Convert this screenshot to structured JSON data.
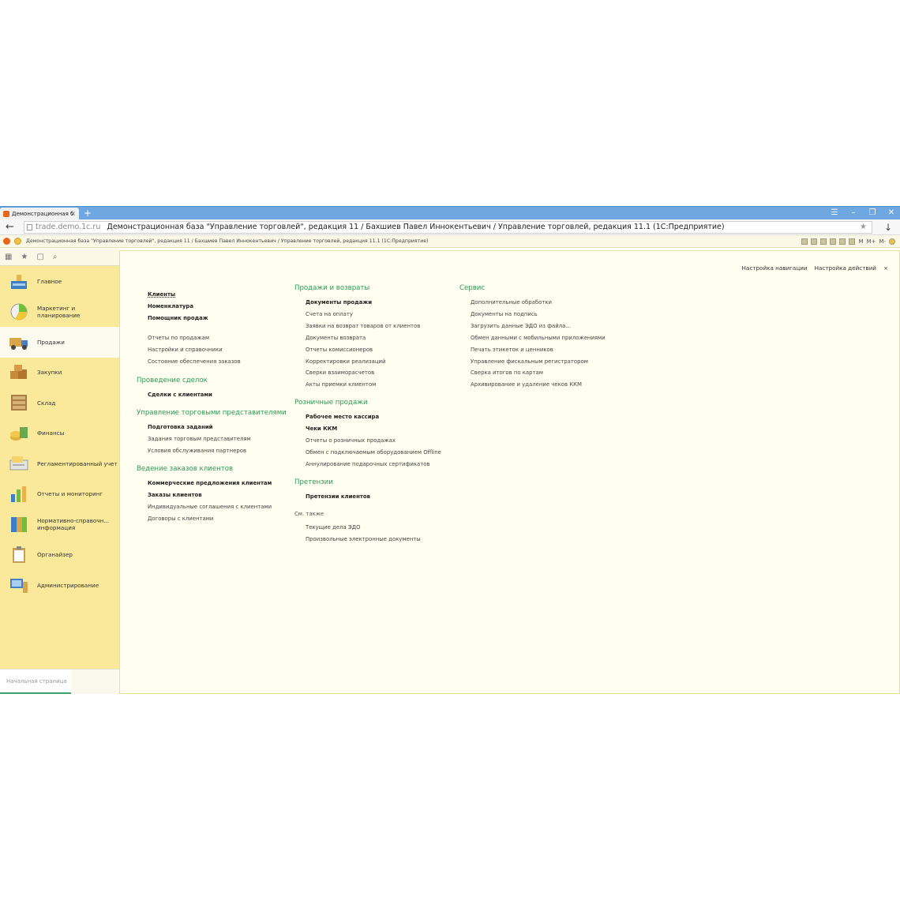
{
  "browser": {
    "tab_title": "Демонстрационная б",
    "tab_close": "×",
    "new_tab": "+",
    "window_controls": [
      "☰",
      "–",
      "❐",
      "✕"
    ],
    "back": "←",
    "url_domain": "trade.demo.1c.ru",
    "url_title": "Демонстрационная база \"Управление торговлей\", редакция 11 / Бахшиев Павел Иннокентьевич / Управление торговлей, редакция 11.1 (1С:Предприятие)",
    "star": "★",
    "download": "↓"
  },
  "app_header": {
    "title": "Демонстрационная база \"Управление торговлей\", редакция 11 / Бахшиев Павел Иннокентьевич / Управление торговлей, редакция 11.1 (1С:Предприятие)",
    "tool_labels": [
      "M",
      "M+",
      "M-"
    ]
  },
  "toolstrip": {
    "icons": [
      "apps-grid-icon",
      "favorites-star-icon",
      "history-icon",
      "search-icon"
    ]
  },
  "sidebar": {
    "items": [
      {
        "label": "Главное",
        "icon": "home-icon"
      },
      {
        "label": "Маркетинг и планирование",
        "icon": "marketing-icon"
      },
      {
        "label": "Продажи",
        "icon": "sales-truck-icon",
        "active": true
      },
      {
        "label": "Закупки",
        "icon": "purchases-boxes-icon"
      },
      {
        "label": "Склад",
        "icon": "warehouse-icon"
      },
      {
        "label": "Финансы",
        "icon": "finance-coins-icon"
      },
      {
        "label": "Регламентированный учет",
        "icon": "accounting-icon"
      },
      {
        "label": "Отчеты и мониторинг",
        "icon": "reports-chart-icon"
      },
      {
        "label": "Нормативно-справочн... информация",
        "icon": "reference-books-icon"
      },
      {
        "label": "Органайзер",
        "icon": "organizer-clipboard-icon"
      },
      {
        "label": "Администрирование",
        "icon": "admin-computer-icon"
      }
    ],
    "start_tab": "Начальная страница"
  },
  "content": {
    "nav_settings": "Настройка навигации",
    "action_settings": "Настройка действий",
    "close": "×",
    "col1": {
      "top_links": [
        {
          "label": "Клиенты",
          "bold": true
        },
        {
          "label": "Номенклатура",
          "bold": true
        },
        {
          "label": "Помощник продаж",
          "bold": true
        }
      ],
      "more_links": [
        "Отчеты по продажам",
        "Настройки и справочники",
        "Состояние обеспечения заказов"
      ],
      "sections": [
        {
          "title": "Проведение сделок",
          "links": [
            {
              "label": "Сделки с клиентами",
              "bold": true
            }
          ]
        },
        {
          "title": "Управление торговыми представителями",
          "links": [
            {
              "label": "Подготовка заданий",
              "bold": true
            },
            {
              "label": "Задания торговым представителям",
              "bold": false
            },
            {
              "label": "Условия обслуживания партнеров",
              "bold": false
            }
          ]
        },
        {
          "title": "Ведение заказов клиентов",
          "links": [
            {
              "label": "Коммерческие предложения клиентам",
              "bold": true
            },
            {
              "label": "Заказы клиентов",
              "bold": true
            },
            {
              "label": "Индивидуальные соглашения с клиентами",
              "bold": false
            },
            {
              "label": "Договоры с клиентами",
              "bold": false
            }
          ]
        }
      ]
    },
    "col2": {
      "sections": [
        {
          "title": "Продажи и возвраты",
          "links": [
            {
              "label": "Документы продажи",
              "bold": true
            },
            {
              "label": "Счета на оплату",
              "bold": false
            },
            {
              "label": "Заявки на возврат товаров от клиентов",
              "bold": false
            },
            {
              "label": "Документы возврата",
              "bold": false
            },
            {
              "label": "Отчеты комиссионеров",
              "bold": false
            },
            {
              "label": "Корректировки реализаций",
              "bold": false
            },
            {
              "label": "Сверки взаиморасчетов",
              "bold": false
            },
            {
              "label": "Акты приемки клиентом",
              "bold": false
            }
          ]
        },
        {
          "title": "Розничные продажи",
          "links": [
            {
              "label": "Рабочее место кассира",
              "bold": true
            },
            {
              "label": "Чеки ККМ",
              "bold": true
            },
            {
              "label": "Отчеты о розничных продажах",
              "bold": false
            },
            {
              "label": "Обмен с подключаемым оборудованием Offline",
              "bold": false
            },
            {
              "label": "Аннулирование подарочных сертификатов",
              "bold": false
            }
          ]
        },
        {
          "title": "Претензии",
          "links": [
            {
              "label": "Претензии клиентов",
              "bold": true
            }
          ]
        }
      ],
      "see_also": "См. также",
      "see_also_links": [
        "Текущие дела ЭДО",
        "Произвольные электронные документы"
      ]
    },
    "col3": {
      "sections": [
        {
          "title": "Сервис",
          "links": [
            {
              "label": "Дополнительные обработки",
              "bold": false
            },
            {
              "label": "Документы на подпись",
              "bold": false
            },
            {
              "label": "Загрузить данные ЭДО из файла...",
              "bold": false
            },
            {
              "label": "Обмен данными с мобильными приложениями",
              "bold": false
            },
            {
              "label": "Печать этикеток и ценников",
              "bold": false
            },
            {
              "label": "Управление фискальным регистратором",
              "bold": false
            },
            {
              "label": "Сверка итогов по картам",
              "bold": false
            },
            {
              "label": "Архивирование и удаление чеков ККМ",
              "bold": false
            }
          ]
        }
      ]
    }
  }
}
